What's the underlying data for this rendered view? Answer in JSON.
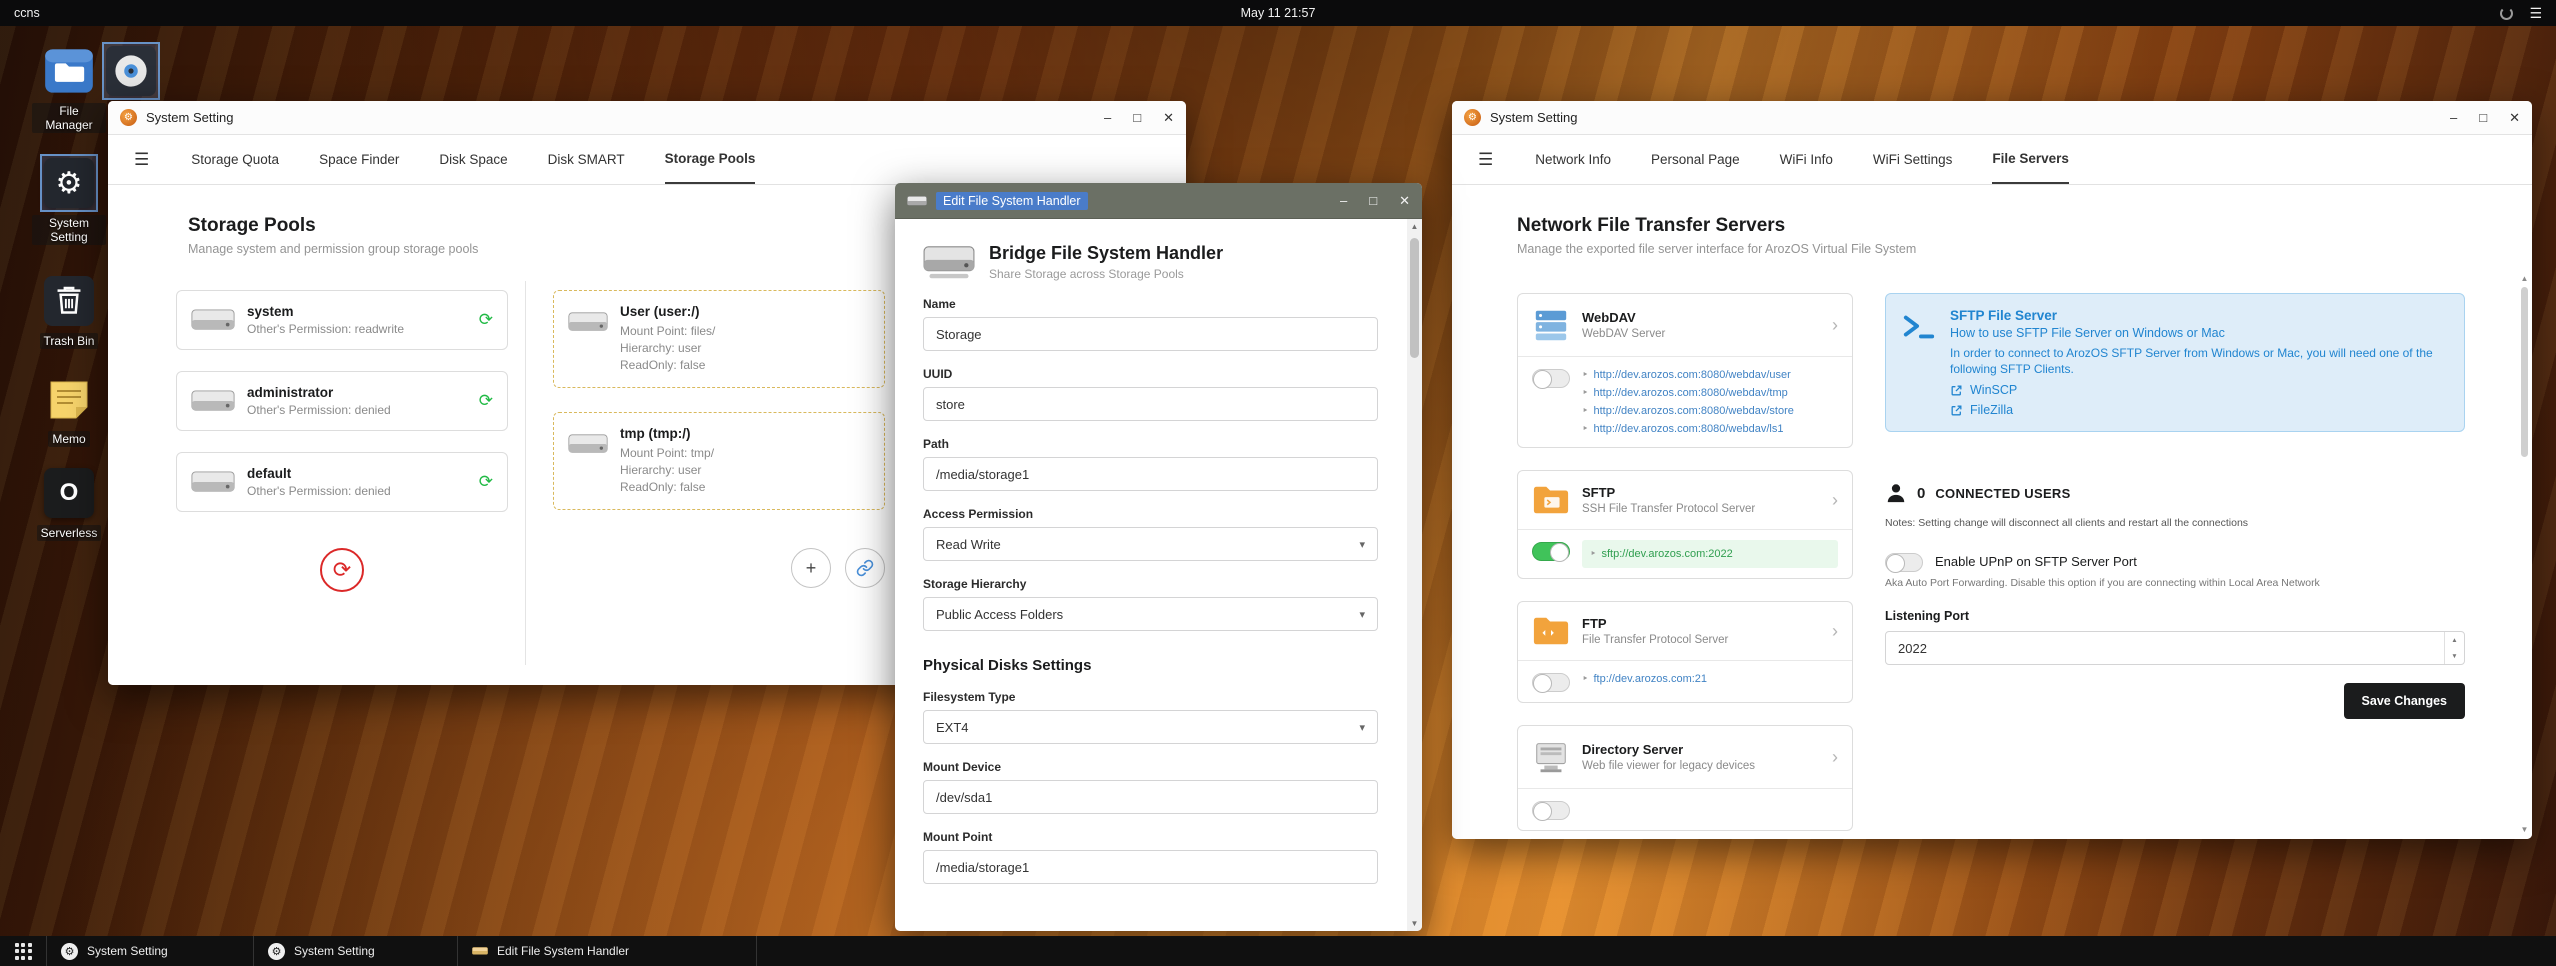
{
  "icons": {
    "gear": "⚙",
    "hamburger": "☰",
    "sync": "⟳",
    "caret": "▾",
    "chevron": "›",
    "bullet": "‣",
    "minimize": "–",
    "maximize": "□",
    "close": "✕",
    "plus": "+",
    "up": "▲",
    "down": "▼",
    "serverless_mark": "O",
    "refresh": "⟳",
    "menu": "☰"
  },
  "topbar": {
    "host": "ccns",
    "clock": "May 11 21:57"
  },
  "desktop": {
    "icons": [
      {
        "label": "File Manager"
      },
      {
        "label": "System Setting"
      },
      {
        "label": "Trash Bin"
      },
      {
        "label": "Memo"
      },
      {
        "label": "Serverless"
      }
    ]
  },
  "window1": {
    "title": "System Setting",
    "tabs": [
      {
        "label": "Storage Quota"
      },
      {
        "label": "Space Finder"
      },
      {
        "label": "Disk Space"
      },
      {
        "label": "Disk SMART"
      },
      {
        "label": "Storage Pools"
      }
    ],
    "heading": "Storage Pools",
    "subheading": "Manage system and permission group storage pools",
    "pools": [
      {
        "name": "system",
        "detail": "Other's Permission: readwrite"
      },
      {
        "name": "administrator",
        "detail": "Other's Permission: denied"
      },
      {
        "name": "default",
        "detail": "Other's Permission: denied"
      }
    ],
    "mounts": [
      {
        "name": "User (user:/)",
        "line1": "Mount Point: files/",
        "line2": "Hierarchy: user",
        "line3": "ReadOnly: false"
      },
      {
        "name": "tmp (tmp:/)",
        "line1": "Mount Point: tmp/",
        "line2": "Hierarchy: user",
        "line3": "ReadOnly: false"
      }
    ]
  },
  "window2": {
    "title": "Edit File System Handler",
    "header": {
      "title": "Bridge File System Handler",
      "subtitle": "Share Storage across Storage Pools"
    },
    "name_label": "Name",
    "name_value": "Storage",
    "uuid_label": "UUID",
    "uuid_value": "store",
    "path_label": "Path",
    "path_value": "/media/storage1",
    "access_label": "Access Permission",
    "access_value": "Read Write",
    "hier_label": "Storage Hierarchy",
    "hier_value": "Public Access Folders",
    "section": "Physical Disks Settings",
    "fs_label": "Filesystem Type",
    "fs_value": "EXT4",
    "mdev_label": "Mount Device",
    "mdev_value": "/dev/sda1",
    "mpt_label": "Mount Point",
    "mpt_value": "/media/storage1"
  },
  "window3": {
    "title": "System Setting",
    "tabs": [
      {
        "label": "Network Info"
      },
      {
        "label": "Personal Page"
      },
      {
        "label": "WiFi Info"
      },
      {
        "label": "WiFi Settings"
      },
      {
        "label": "File Servers"
      }
    ],
    "heading": "Network File Transfer Servers",
    "subheading": "Manage the exported file server interface for ArozOS Virtual File System",
    "webdav": {
      "name": "WebDAV",
      "desc": "WebDAV Server",
      "links": [
        "http://dev.arozos.com:8080/webdav/user",
        "http://dev.arozos.com:8080/webdav/tmp",
        "http://dev.arozos.com:8080/webdav/store",
        "http://dev.arozos.com:8080/webdav/ls1"
      ]
    },
    "sftp": {
      "name": "SFTP",
      "desc": "SSH File Transfer Protocol Server",
      "link": "sftp://dev.arozos.com:2022"
    },
    "ftp": {
      "name": "FTP",
      "desc": "File Transfer Protocol Server",
      "link": "ftp://dev.arozos.com:21"
    },
    "dirserver": {
      "name": "Directory Server",
      "desc": "Web file viewer for legacy devices"
    },
    "panel": {
      "title": "SFTP File Server",
      "subtitle": "How to use SFTP File Server on Windows or Mac",
      "body": "In order to connect to ArozOS SFTP Server from Windows or Mac, you will need one of the following SFTP Clients.",
      "client1": "WinSCP",
      "client2": "FileZilla"
    },
    "connected": {
      "count": "0",
      "label": "CONNECTED USERS",
      "notes": "Notes: Setting change will disconnect all clients and restart all the connections"
    },
    "upnp": {
      "label": "Enable UPnP on SFTP Server Port",
      "hint": "Aka Auto Port Forwarding. Disable this option if you are connecting within Local Area Network"
    },
    "port": {
      "label": "Listening Port",
      "value": "2022"
    },
    "save_label": "Save Changes"
  },
  "taskbar": {
    "items": [
      {
        "label": "System Setting"
      },
      {
        "label": "System Setting"
      },
      {
        "label": "Edit File System Handler"
      }
    ]
  }
}
